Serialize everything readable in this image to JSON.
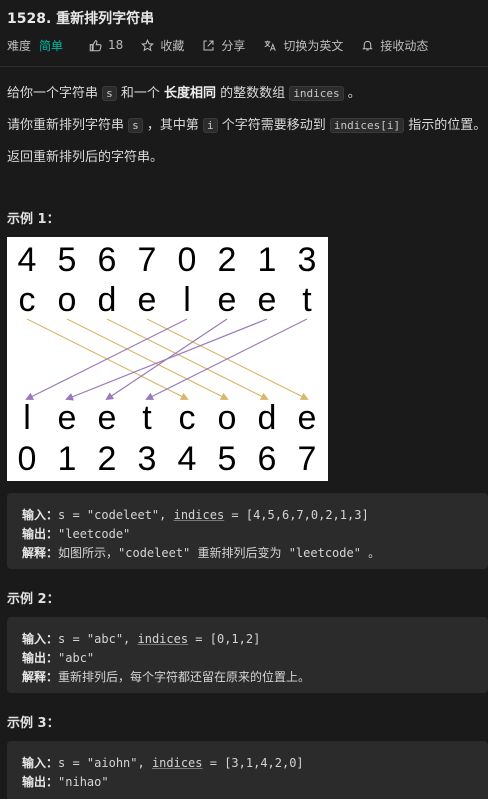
{
  "problem": {
    "title": "1528. 重新排列字符串",
    "difficulty_label": "难度",
    "difficulty": "简单",
    "likes": "18",
    "favorite_label": "收藏",
    "share_label": "分享",
    "switch_lang_label": "切换为英文",
    "subscribe_label": "接收动态"
  },
  "description": {
    "p1": {
      "a": "给你一个字符串 ",
      "s": "s",
      "b": " 和一个 ",
      "bold": "长度相同",
      "c": " 的整数数组 ",
      "code": "indices",
      "d": " 。"
    },
    "p2": {
      "a": "请你重新排列字符串 ",
      "s": "s",
      "b": " ，其中第 ",
      "i": "i",
      "c": " 个字符需要移动到 ",
      "code": "indices[i]",
      "d": " 指示的位置。"
    },
    "p3": "返回重新排列后的字符串。"
  },
  "examples": [
    {
      "title": "示例 1：",
      "figure": {
        "top_indices": [
          "4",
          "5",
          "6",
          "7",
          "0",
          "2",
          "1",
          "3"
        ],
        "top_chars": [
          "c",
          "o",
          "d",
          "e",
          "l",
          "e",
          "e",
          "t"
        ],
        "bottom_chars": [
          "l",
          "e",
          "e",
          "t",
          "c",
          "o",
          "d",
          "e"
        ],
        "bottom_indices": [
          "0",
          "1",
          "2",
          "3",
          "4",
          "5",
          "6",
          "7"
        ],
        "arrow_colors": {
          "right": "#d9b86a",
          "left": "#9a7ab8"
        }
      },
      "input_label": "输入：",
      "input_pre": "s = \"codeleet\", ",
      "input_kw": "indices",
      "input_post": " = [4,5,6,7,0,2,1,3]",
      "output_label": "输出：",
      "output": "\"leetcode\"",
      "explain_label": "解释：",
      "explain": "如图所示，\"codeleet\" 重新排列后变为 \"leetcode\" 。"
    },
    {
      "title": "示例 2：",
      "input_label": "输入：",
      "input_pre": "s = \"abc\", ",
      "input_kw": "indices",
      "input_post": " = [0,1,2]",
      "output_label": "输出：",
      "output": "\"abc\"",
      "explain_label": "解释：",
      "explain": "重新排列后，每个字符都还留在原来的位置上。"
    },
    {
      "title": "示例 3：",
      "input_label": "输入：",
      "input_pre": "s = \"aiohn\", ",
      "input_kw": "indices",
      "input_post": " = [3,1,4,2,0]",
      "output_label": "输出：",
      "output": "\"nihao\""
    }
  ]
}
